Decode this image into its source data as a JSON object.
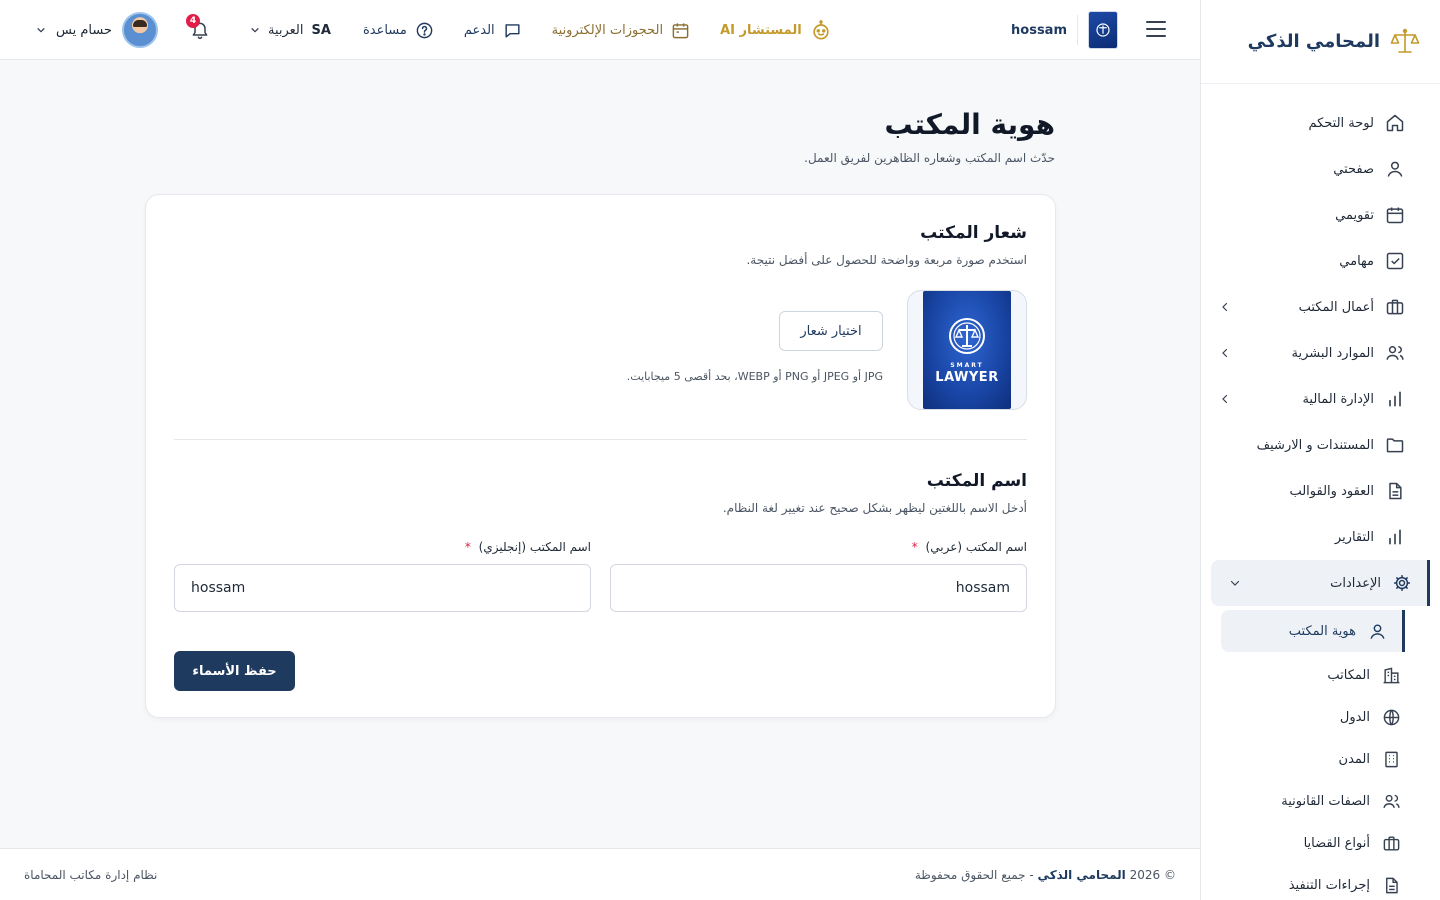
{
  "brand": {
    "title": "المحامي الذكي"
  },
  "topbar": {
    "office_name": "hossam",
    "ai_label": "المستشار AI",
    "bookings_label": "الحجوزات الإلكترونية",
    "support_label": "الدعم",
    "help_label": "مساعدة",
    "language_label": "العربية",
    "language_code": "SA",
    "notification_count": "4",
    "user_name": "حسام يس"
  },
  "sidebar": {
    "items": [
      {
        "label": "لوحة التحكم",
        "icon": "home-icon"
      },
      {
        "label": "صفحتي",
        "icon": "user-icon"
      },
      {
        "label": "تقويمي",
        "icon": "calendar-icon"
      },
      {
        "label": "مهامي",
        "icon": "checkbox-icon"
      },
      {
        "label": "أعمال المكتب",
        "icon": "briefcase-icon",
        "expandable": true
      },
      {
        "label": "الموارد البشرية",
        "icon": "users-icon",
        "expandable": true
      },
      {
        "label": "الإدارة المالية",
        "icon": "chart-icon",
        "expandable": true
      },
      {
        "label": "المستندات و الارشيف",
        "icon": "folder-icon"
      },
      {
        "label": "العقود والقوالب",
        "icon": "document-icon"
      },
      {
        "label": "التقارير",
        "icon": "chart-icon"
      },
      {
        "label": "الإعدادات",
        "icon": "gear-icon",
        "expanded": true
      }
    ],
    "settings_sub": [
      {
        "label": "هوية المكتب",
        "icon": "user-icon",
        "active": true
      },
      {
        "label": "المكاتب",
        "icon": "building-icon"
      },
      {
        "label": "الدول",
        "icon": "globe-icon"
      },
      {
        "label": "المدن",
        "icon": "city-icon"
      },
      {
        "label": "الصفات القانونية",
        "icon": "users-icon"
      },
      {
        "label": "أنواع القضايا",
        "icon": "briefcase-icon"
      },
      {
        "label": "إجراءات التنفيذ",
        "icon": "document-icon"
      }
    ]
  },
  "page": {
    "title": "هوية المكتب",
    "subtitle": "حدّث اسم المكتب وشعاره الظاهرين لفريق العمل."
  },
  "logo_section": {
    "title": "شعار المكتب",
    "subtitle": "استخدم صورة مربعة وواضحة للحصول على أفضل نتيجة.",
    "choose_button": "اختيار شعار",
    "file_hint": "JPG أو JPEG أو PNG أو WEBP، بحد أقصى 5 ميجابايت.",
    "logo_text_top": "SMART",
    "logo_text_main": "LAWYER"
  },
  "name_section": {
    "title": "اسم المكتب",
    "subtitle": "أدخل الاسم باللغتين ليظهر بشكل صحيح عند تغيير لغة النظام.",
    "arabic_label": "اسم المكتب (عربي)",
    "arabic_value": "hossam",
    "english_label": "اسم المكتب (إنجليزي)",
    "english_value": "hossam",
    "required_mark": "*",
    "save_button": "حفظ الأسماء"
  },
  "footer": {
    "copyright_prefix": "© 2026",
    "brand": "المحامي الذكي",
    "rights": "- جميع الحقوق محفوظة",
    "system": "نظام إدارة مكاتب المحاماة"
  },
  "colors": {
    "primary": "#1f3a5f",
    "accent_gold": "#c49a2c",
    "danger": "#e11d48",
    "background": "#f7f8fa"
  }
}
